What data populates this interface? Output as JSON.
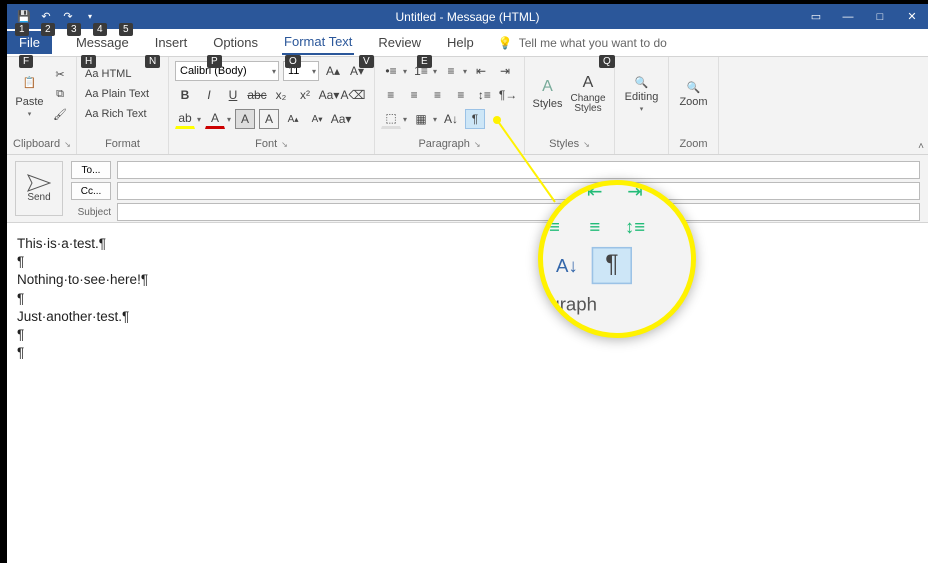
{
  "title": "Untitled  -  Message (HTML)",
  "keytips": {
    "q1": "1",
    "q2": "2",
    "q3": "3",
    "q4": "4",
    "q5": "5",
    "file": "F",
    "home": "H",
    "insert": "N",
    "options": "P",
    "format": "O",
    "review": "V",
    "help": "E",
    "tellme": "Q"
  },
  "tabs": {
    "file": "File",
    "message": "Message",
    "insert": "Insert",
    "options": "Options",
    "format": "Format Text",
    "review": "Review",
    "help": "Help",
    "tellme": "Tell me what you want to do"
  },
  "ribbon": {
    "clipboard": {
      "label": "Clipboard",
      "paste": "Paste"
    },
    "format": {
      "label": "Format",
      "html": "Aa HTML",
      "plain": "Aa Plain Text",
      "rich": "Aa Rich Text"
    },
    "font": {
      "label": "Font",
      "name": "Calibri (Body)",
      "size": "11"
    },
    "paragraph": {
      "label": "Paragraph"
    },
    "styles": {
      "label": "Styles",
      "styles_btn": "Styles",
      "change": "Change Styles"
    },
    "editing": {
      "label": "Editing"
    },
    "zoom": {
      "label": "Zoom",
      "btn": "Zoom"
    }
  },
  "envelope": {
    "send": "Send",
    "to": "To...",
    "cc": "Cc...",
    "subject": "Subject"
  },
  "body": {
    "l1": "This·is·a·test.¶",
    "l2": "¶",
    "l3": "Nothing·to·see·here!¶",
    "l4": "¶",
    "l5": "Just·another·test.¶",
    "l6": "¶",
    "l7": "¶"
  },
  "magnifier": {
    "paragraph": "agraph"
  }
}
